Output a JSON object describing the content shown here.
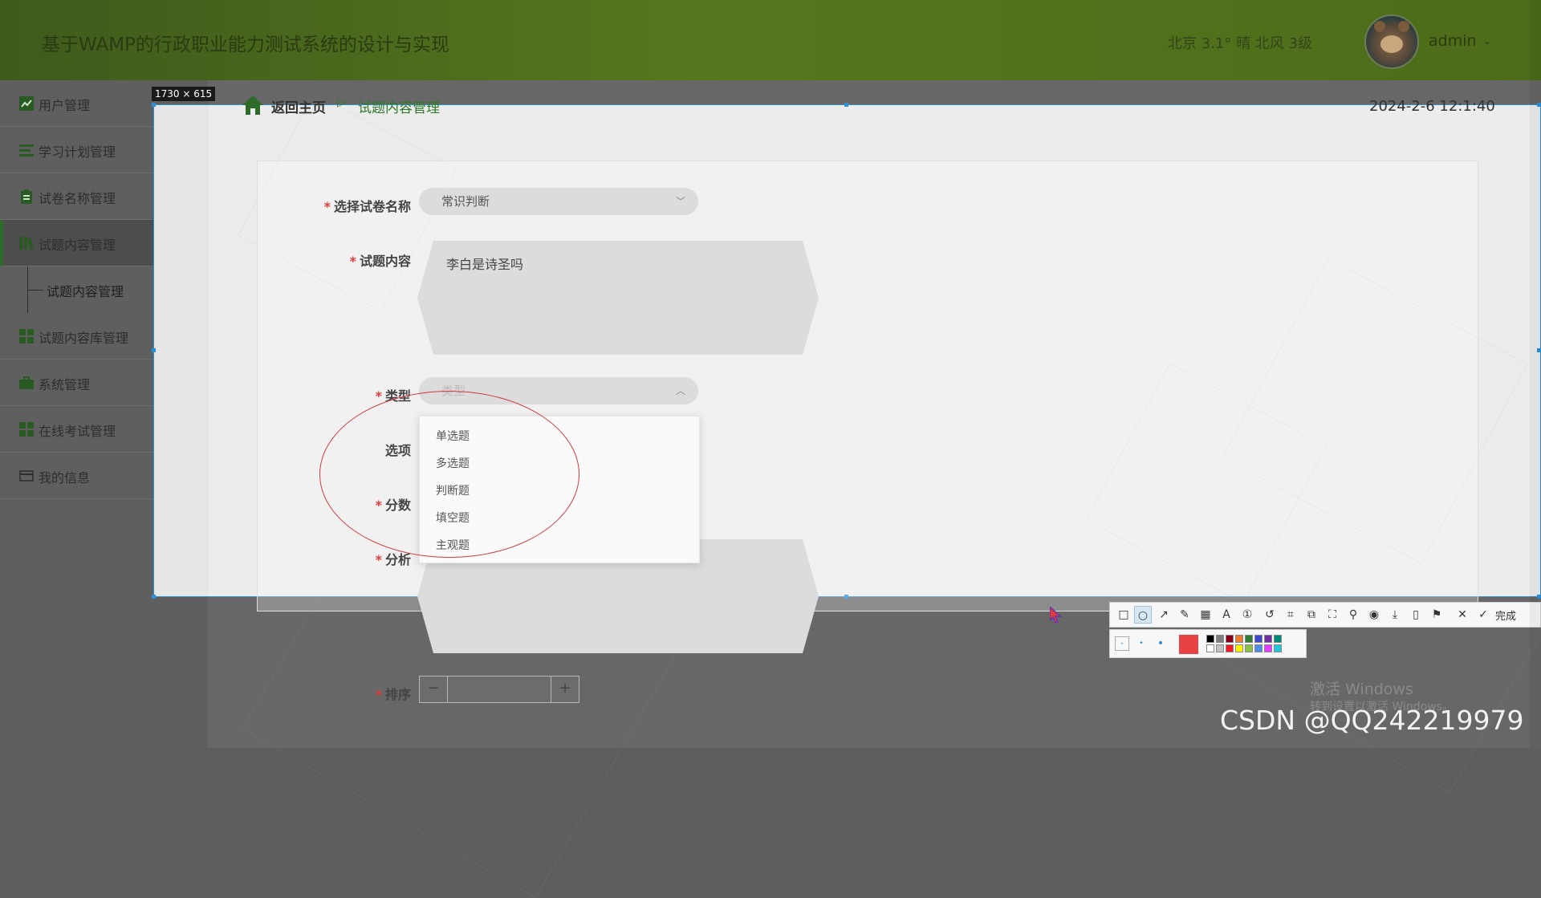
{
  "header": {
    "title": "基于WAMP的行政职业能力测试系统的设计与实现",
    "weather": "北京  3.1°  晴  北风  3级",
    "user": "admin"
  },
  "sidebar": {
    "items": [
      {
        "label": "用户管理",
        "icon": "chart-icon"
      },
      {
        "label": "学习计划管理",
        "icon": "list-icon"
      },
      {
        "label": "试卷名称管理",
        "icon": "clipboard-icon"
      },
      {
        "label": "试题内容管理",
        "icon": "books-icon",
        "active": true
      },
      {
        "label": "试题内容库管理",
        "icon": "grid-icon"
      },
      {
        "label": "系统管理",
        "icon": "briefcase-icon"
      },
      {
        "label": "在线考试管理",
        "icon": "grid-icon"
      },
      {
        "label": "我的信息",
        "icon": "card-icon"
      }
    ],
    "sub_item": "试题内容管理"
  },
  "breadcrumb": {
    "home": "返回主页",
    "separator": "▷",
    "current": "试题内容管理"
  },
  "datetime": "2024-2-6 12:1:40",
  "form": {
    "paper_name": {
      "label": "选择试卷名称",
      "value": "常识判断"
    },
    "content": {
      "label": "试题内容",
      "value": "李白是诗圣吗"
    },
    "type": {
      "label": "类型",
      "placeholder": "类型"
    },
    "options": {
      "label": "选项"
    },
    "score": {
      "label": "分数"
    },
    "analysis": {
      "label": "分析"
    },
    "sort": {
      "label": "排序"
    },
    "type_options": [
      "单选题",
      "多选题",
      "判断题",
      "填空题",
      "主观题"
    ]
  },
  "selection": {
    "size_label": "1730 × 615"
  },
  "snip_toolbar": {
    "done_label": "完成"
  },
  "watermarks": {
    "windows": "激活 Windows",
    "windows_sub": "转到设置以激活 Windows。",
    "csdn": "CSDN @QQ242219979"
  },
  "colors": {
    "header_green": "#56771d",
    "accent_green": "#2e7b2a",
    "required_red": "#e23b3b",
    "selection_blue": "#2e8fd6"
  }
}
